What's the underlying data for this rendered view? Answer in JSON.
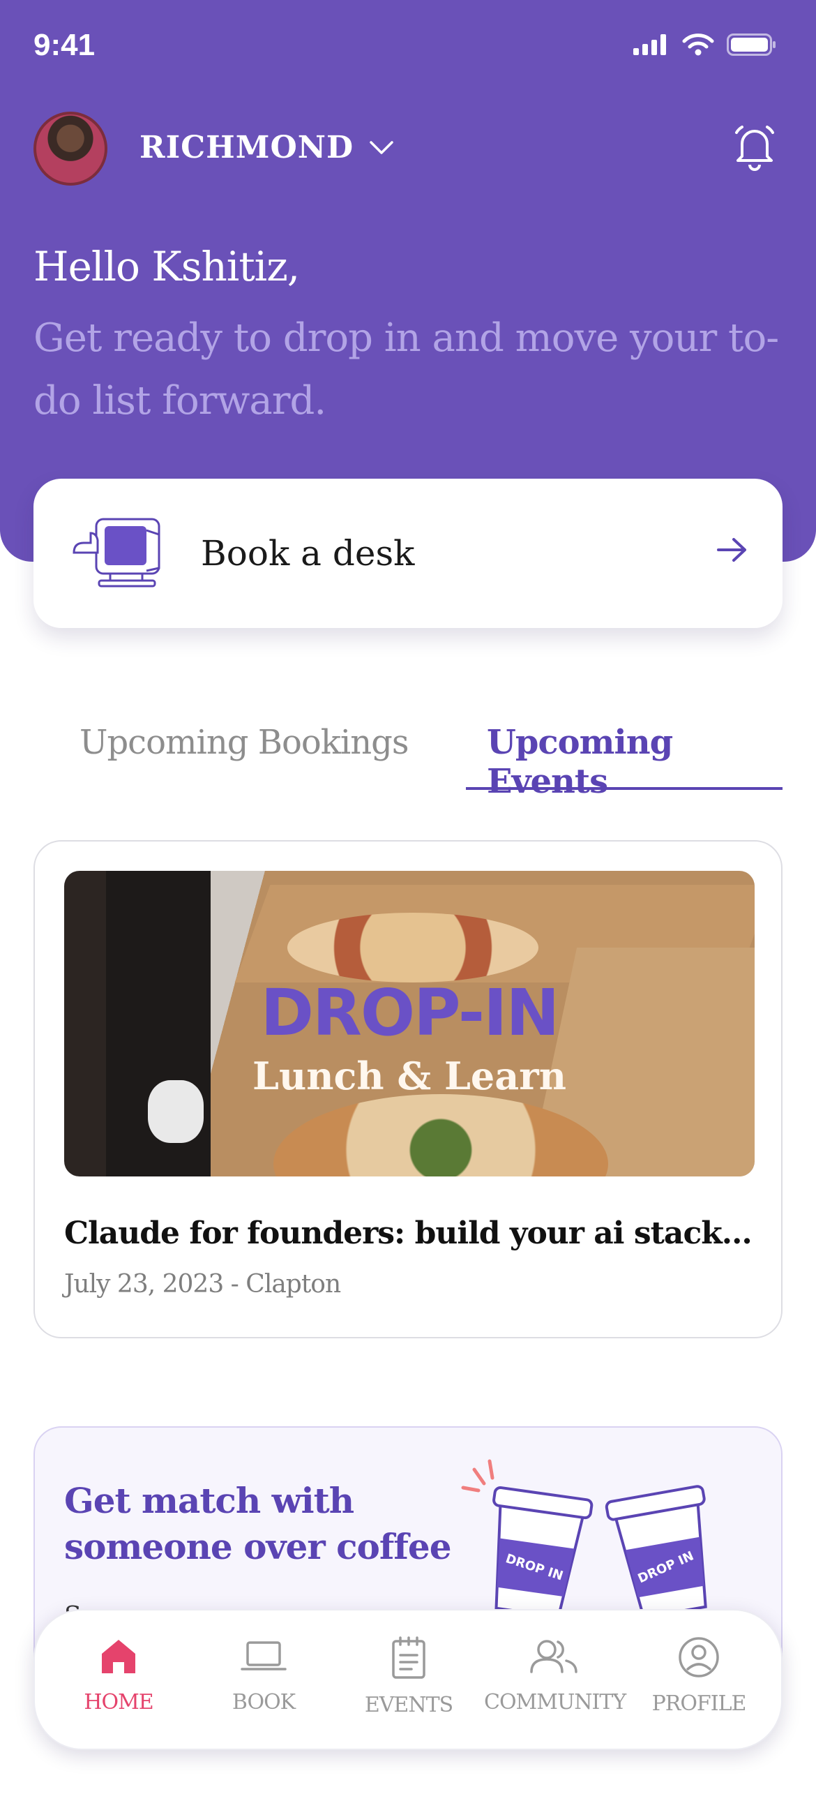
{
  "status_bar": {
    "time": "9:41"
  },
  "header": {
    "location": "RICHMOND",
    "greeting": "Hello Kshitiz,",
    "subtitle": "Get ready to drop in and move your to-do list forward."
  },
  "book_card": {
    "label": "Book a desk"
  },
  "tabs": [
    {
      "label": "Upcoming Bookings",
      "active": false
    },
    {
      "label": "Upcoming Events",
      "active": true
    }
  ],
  "event": {
    "image_title": "DROP-IN",
    "image_subtitle": "Lunch & Learn",
    "title": "Claude for founders: build your ai stack in...",
    "meta": "July 23, 2023 - Clapton"
  },
  "coffee_card": {
    "title": "Get match with someone over coffee",
    "subtitle": "S...",
    "cup_label": "DROP IN"
  },
  "nav": [
    {
      "label": "HOME",
      "icon": "home-icon",
      "active": true
    },
    {
      "label": "BOOK",
      "icon": "laptop-icon",
      "active": false
    },
    {
      "label": "EVENTS",
      "icon": "notepad-icon",
      "active": false
    },
    {
      "label": "COMMUNITY",
      "icon": "users-icon",
      "active": false
    },
    {
      "label": "PROFILE",
      "icon": "profile-icon",
      "active": false
    }
  ],
  "colors": {
    "brand_purple": "#6a51b8",
    "accent_pink": "#e5436c",
    "subtitle_lilac": "#b2a4e6"
  }
}
